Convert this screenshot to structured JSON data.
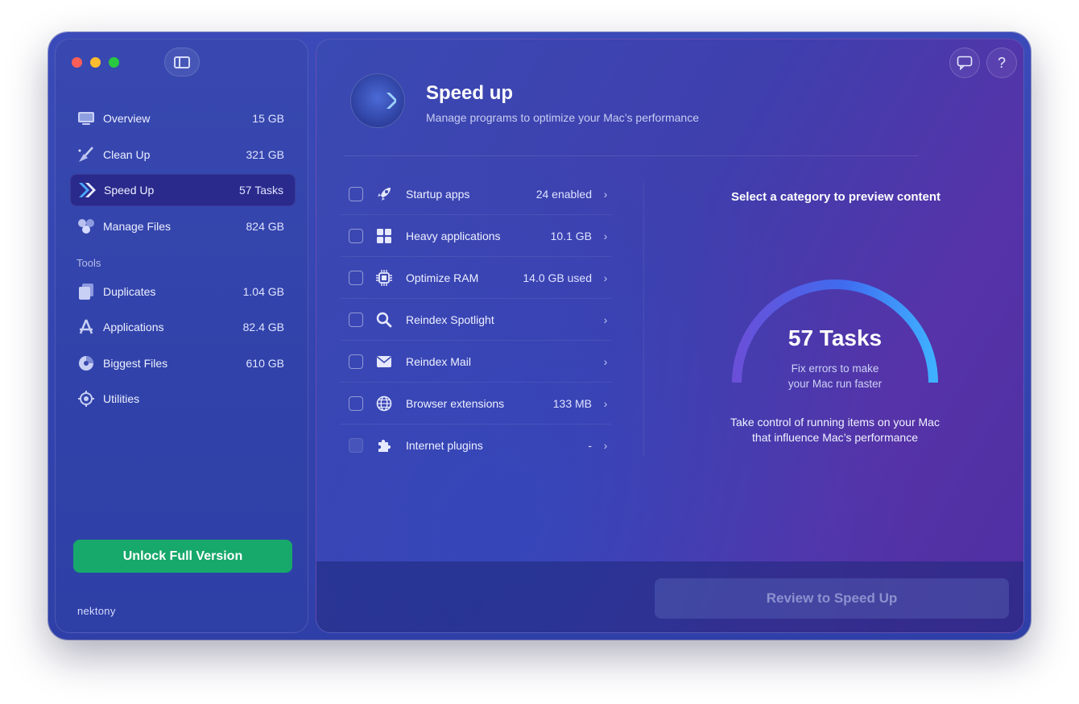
{
  "window": {
    "traffic_lights": [
      "close",
      "minimize",
      "zoom"
    ]
  },
  "sidebar": {
    "items": [
      {
        "label": "Overview",
        "value": "15 GB",
        "icon": "overview-icon"
      },
      {
        "label": "Clean Up",
        "value": "321 GB",
        "icon": "broom-icon"
      },
      {
        "label": "Speed Up",
        "value": "57 Tasks",
        "icon": "speed-chevrons-icon",
        "active": true
      },
      {
        "label": "Manage Files",
        "value": "824 GB",
        "icon": "files-icon"
      }
    ],
    "tools_title": "Tools",
    "tools": [
      {
        "label": "Duplicates",
        "value": "1.04 GB",
        "icon": "duplicates-icon"
      },
      {
        "label": "Applications",
        "value": "82.4 GB",
        "icon": "applications-icon"
      },
      {
        "label": "Biggest Files",
        "value": "610 GB",
        "icon": "pie-chart-icon"
      },
      {
        "label": "Utilities",
        "value": "",
        "icon": "gear-icon"
      }
    ],
    "unlock_label": "Unlock Full Version",
    "brand": "nektony"
  },
  "header": {
    "title": "Speed up",
    "subtitle": "Manage programs to optimize your Mac’s performance"
  },
  "top_buttons": {
    "feedback_icon": "chat-bubble-icon",
    "help_label": "?"
  },
  "categories": [
    {
      "label": "Startup apps",
      "value": "24 enabled",
      "icon": "rocket-icon",
      "enabled": true
    },
    {
      "label": "Heavy applications",
      "value": "10.1 GB",
      "icon": "grid-icon",
      "enabled": true
    },
    {
      "label": "Optimize RAM",
      "value": "14.0 GB used",
      "icon": "chip-icon",
      "enabled": true
    },
    {
      "label": "Reindex Spotlight",
      "value": "",
      "icon": "search-icon",
      "enabled": true
    },
    {
      "label": "Reindex Mail",
      "value": "",
      "icon": "mail-icon",
      "enabled": true
    },
    {
      "label": "Browser extensions",
      "value": "133 MB",
      "icon": "globe-icon",
      "enabled": true
    },
    {
      "label": "Internet plugins",
      "value": "-",
      "icon": "puzzle-icon",
      "enabled": false
    }
  ],
  "preview": {
    "title": "Select a category to preview content",
    "gauge_count": "57 Tasks",
    "gauge_line1": "Fix errors to make",
    "gauge_line2": "your Mac run faster",
    "desc_line1": "Take control of running items on your Mac",
    "desc_line2": "that influence Mac’s performance"
  },
  "footer": {
    "review_label": "Review to Speed Up"
  },
  "colors": {
    "accent_green": "#17a86b",
    "gauge_start": "#6a4fd8",
    "gauge_end": "#3fb0ff"
  }
}
